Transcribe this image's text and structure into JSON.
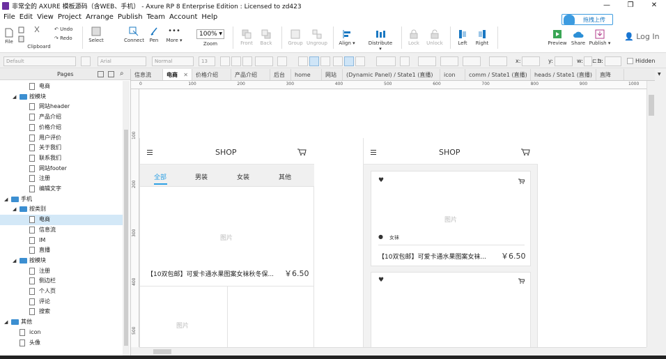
{
  "window": {
    "title": "非常全的 AXURE 模板源码（含WEB、手机） - Axure RP 8 Enterprise Edition : Licensed to zd423",
    "buttons": [
      "—",
      "❐",
      "✕"
    ]
  },
  "menu": [
    "File",
    "Edit",
    "View",
    "Project",
    "Arrange",
    "Publish",
    "Team",
    "Account",
    "Help"
  ],
  "toolbar": {
    "file": "File",
    "clipboard": "Clipboard",
    "undo": "Undo",
    "redo": "Redo",
    "select": "Select",
    "connect": "Connect",
    "pen": "Pen",
    "more": "More ▾",
    "zoom_value": "100%",
    "zoom": "Zoom",
    "front": "Front",
    "back": "Back",
    "group": "Group",
    "ungroup": "Ungroup",
    "align": "Align ▾",
    "distribute": "Distribute ▾",
    "lock": "Lock",
    "unlock": "Unlock",
    "left": "Left",
    "right": "Right",
    "preview": "Preview",
    "share": "Share",
    "publish": "Publish ▾",
    "upload": "拖拽上传",
    "login": "Log In"
  },
  "format": {
    "style": "Default",
    "font": "Arial",
    "weight": "Normal",
    "size": "13",
    "x_label": "x:",
    "y_label": "y:",
    "w_label": "w:",
    "h_label": "h:",
    "hidden": "Hidden"
  },
  "pages_panel": {
    "title": "Pages",
    "items": [
      {
        "label": "电商",
        "type": "page",
        "level": 3
      },
      {
        "label": "按模块",
        "type": "folder",
        "level": 2
      },
      {
        "label": "网站header",
        "type": "page",
        "level": 3
      },
      {
        "label": "产品介绍",
        "type": "page",
        "level": 3
      },
      {
        "label": "价格介绍",
        "type": "page",
        "level": 3
      },
      {
        "label": "用户评价",
        "type": "page",
        "level": 3
      },
      {
        "label": "关于我们",
        "type": "page",
        "level": 3
      },
      {
        "label": "联系我们",
        "type": "page",
        "level": 3
      },
      {
        "label": "网站footer",
        "type": "page",
        "level": 3
      },
      {
        "label": "注册",
        "type": "page",
        "level": 3
      },
      {
        "label": "编辑文字",
        "type": "page",
        "level": 3
      },
      {
        "label": "手机",
        "type": "folder",
        "level": 1
      },
      {
        "label": "按类别",
        "type": "folder",
        "level": 2
      },
      {
        "label": "电商",
        "type": "page",
        "level": 3,
        "selected": true
      },
      {
        "label": "信息流",
        "type": "page",
        "level": 3
      },
      {
        "label": "IM",
        "type": "page",
        "level": 3
      },
      {
        "label": "直播",
        "type": "page",
        "level": 3
      },
      {
        "label": "按模块",
        "type": "folder",
        "level": 2
      },
      {
        "label": "注册",
        "type": "page",
        "level": 3
      },
      {
        "label": "侧边栏",
        "type": "page",
        "level": 3
      },
      {
        "label": "个人页",
        "type": "page",
        "level": 3
      },
      {
        "label": "评论",
        "type": "page",
        "level": 3
      },
      {
        "label": "搜索",
        "type": "page",
        "level": 3
      },
      {
        "label": "其他",
        "type": "folder",
        "level": 1
      },
      {
        "label": "icon",
        "type": "page",
        "level": 2
      },
      {
        "label": "头像",
        "type": "page",
        "level": 2
      }
    ]
  },
  "tabs": [
    {
      "label": "信息流"
    },
    {
      "label": "电商",
      "active": true
    },
    {
      "label": "价格介绍"
    },
    {
      "label": "产品介绍"
    },
    {
      "label": "后台"
    },
    {
      "label": "home"
    },
    {
      "label": "网站"
    },
    {
      "label": "(Dynamic Panel) / State1 (直播)"
    },
    {
      "label": "icon"
    },
    {
      "label": "comm / State1 (直播)"
    },
    {
      "label": "heads / State1 (直播)"
    },
    {
      "label": "直降"
    }
  ],
  "ruler": {
    "h": [
      "0",
      "100",
      "200",
      "300",
      "400",
      "500",
      "600",
      "700",
      "800",
      "900",
      "1000"
    ],
    "v": [
      "100",
      "200",
      "300",
      "400",
      "500"
    ]
  },
  "canvas": {
    "left_phone": {
      "title": "SHOP",
      "categories": [
        "全部",
        "男装",
        "女装",
        "其他"
      ],
      "image": "图片",
      "product": "【10双包邮】可爱卡通水果图案女袜秋冬保...",
      "price": "￥6.50",
      "image2": "图片"
    },
    "right_phone": {
      "title": "SHOP",
      "image": "图片",
      "tag": "女袜",
      "product": "【10双包邮】可爱卡通水果图案女袜...",
      "price": "￥6.50"
    }
  },
  "colors": {
    "accent": "#2da0e4",
    "folder": "#3c8fd1",
    "selection": "#d3e8f7"
  }
}
